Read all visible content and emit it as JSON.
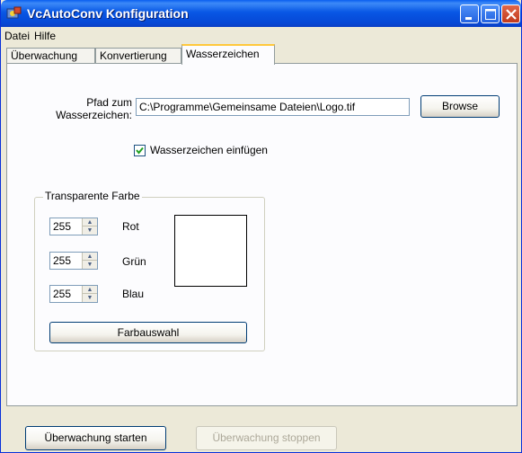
{
  "window": {
    "title": "VcAutoConv Konfiguration",
    "colors": {
      "titlebar": "#0857e5",
      "face": "#ece9d8",
      "close": "#c23a1c"
    }
  },
  "titlebar_buttons": [
    "minimize-icon",
    "maximize-icon",
    "close-icon"
  ],
  "menu": {
    "items": [
      "Datei",
      "Hilfe"
    ]
  },
  "tabs": [
    {
      "label": "Überwachung",
      "active": false
    },
    {
      "label": "Konvertierung",
      "active": false
    },
    {
      "label": "Wasserzeichen",
      "active": true
    }
  ],
  "watermark": {
    "path_label_line1": "Pfad zum",
    "path_label_line2": "Wasserzeichen:",
    "path_value": "C:\\Programme\\Gemeinsame Dateien\\Logo.tif",
    "browse_label": "Browse",
    "insert_checkbox_label": "Wasserzeichen einfügen",
    "insert_checked": true
  },
  "transparent_color": {
    "group_title": "Transparente Farbe",
    "red": {
      "value": "255",
      "label": "Rot"
    },
    "green": {
      "value": "255",
      "label": "Grün"
    },
    "blue": {
      "value": "255",
      "label": "Blau"
    },
    "preview_color": "#ffffff",
    "choose_button": "Farbauswahl"
  },
  "footer": {
    "start_button": "Überwachung starten",
    "stop_button": "Überwachung stoppen",
    "stop_enabled": false
  }
}
